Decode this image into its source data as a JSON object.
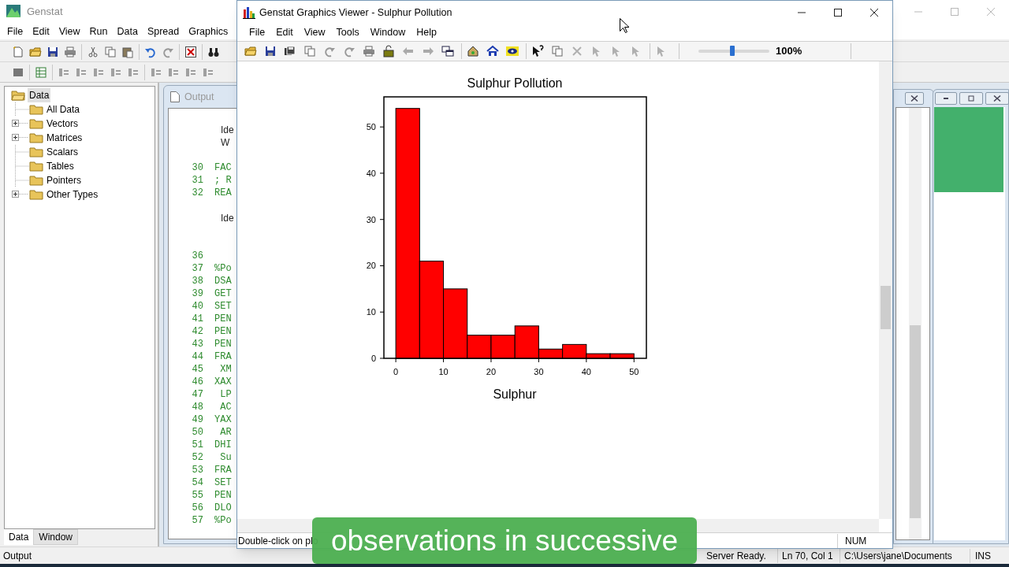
{
  "app": {
    "title": "Genstat",
    "menu": [
      "File",
      "Edit",
      "View",
      "Run",
      "Data",
      "Spread",
      "Graphics"
    ],
    "tree": {
      "label": "Data",
      "selected": true,
      "children": [
        {
          "label": "All Data",
          "expandable": false,
          "selected": false
        },
        {
          "label": "Vectors",
          "expandable": true,
          "selected": false
        },
        {
          "label": "Matrices",
          "expandable": true,
          "selected": false
        },
        {
          "label": "Scalars",
          "expandable": false,
          "selected": false
        },
        {
          "label": "Tables",
          "expandable": false,
          "selected": false
        },
        {
          "label": "Pointers",
          "expandable": false,
          "selected": false
        },
        {
          "label": "Other Types",
          "expandable": true,
          "selected": false
        }
      ]
    },
    "panel_tabs": [
      {
        "label": "Data",
        "selected": true
      },
      {
        "label": "Window",
        "selected": false
      }
    ],
    "status_bar": [
      "Output",
      "Server Ready.",
      "Ln 70, Col 1",
      "C:\\Users\\jane\\Documents",
      "INS"
    ]
  },
  "output_window": {
    "title": "Output",
    "lines": [
      {
        "kind": "heading",
        "text": "Ide"
      },
      {
        "kind": "heading",
        "text": "W"
      },
      {
        "kind": "gap"
      },
      {
        "kind": "code",
        "number": "30",
        "text": "FAC"
      },
      {
        "kind": "code",
        "number": "31",
        "text": "; R"
      },
      {
        "kind": "code",
        "number": "32",
        "text": "REA"
      },
      {
        "kind": "gap"
      },
      {
        "kind": "heading",
        "text": "Ide"
      },
      {
        "kind": "gap"
      },
      {
        "kind": "gap"
      },
      {
        "kind": "code",
        "number": "36"
      },
      {
        "kind": "code",
        "number": "37",
        "text": "%Po"
      },
      {
        "kind": "code",
        "number": "38",
        "text": "DSA"
      },
      {
        "kind": "code",
        "number": "39",
        "text": "GET"
      },
      {
        "kind": "code",
        "number": "40",
        "text": "SET"
      },
      {
        "kind": "code",
        "number": "41",
        "text": "PEN"
      },
      {
        "kind": "code",
        "number": "42",
        "text": "PEN"
      },
      {
        "kind": "code",
        "number": "43",
        "text": "PEN"
      },
      {
        "kind": "code",
        "number": "44",
        "text": "FRA"
      },
      {
        "kind": "code",
        "number": "45",
        "text": " XM"
      },
      {
        "kind": "code",
        "number": "46",
        "text": "XAX"
      },
      {
        "kind": "code",
        "number": "47",
        "text": " LP"
      },
      {
        "kind": "code",
        "number": "48",
        "text": " AC"
      },
      {
        "kind": "code",
        "number": "49",
        "text": "YAX"
      },
      {
        "kind": "code",
        "number": "50",
        "text": " AR"
      },
      {
        "kind": "code",
        "number": "51",
        "text": "DHI"
      },
      {
        "kind": "code",
        "number": "52",
        "text": " Su"
      },
      {
        "kind": "code",
        "number": "53",
        "text": "FRA"
      },
      {
        "kind": "code",
        "number": "54",
        "text": "SET"
      },
      {
        "kind": "code",
        "number": "55",
        "text": "PEN"
      },
      {
        "kind": "code",
        "number": "56",
        "text": "DLO"
      },
      {
        "kind": "code",
        "number": "57",
        "text": "%Po"
      }
    ]
  },
  "graphics_viewer": {
    "title": "Genstat Graphics Viewer - Sulphur Pollution",
    "menu": [
      "File",
      "Edit",
      "View",
      "Tools",
      "Window",
      "Help"
    ],
    "zoom": {
      "level": 0.48,
      "reading": "100%"
    },
    "chart_data": {
      "type": "bar",
      "title": "Sulphur Pollution",
      "xlabel": "Sulphur",
      "x": [
        2.5,
        7.5,
        12.5,
        17.5,
        22.5,
        27.5,
        32.5,
        37.5,
        42.5,
        47.5
      ],
      "values": [
        54,
        21,
        15,
        5,
        5,
        7,
        2,
        3,
        1,
        1
      ],
      "xlim": [
        -2.5,
        52.6
      ],
      "ylim": [
        0,
        56.5
      ],
      "xticks": [
        0,
        10,
        20,
        30,
        40,
        50
      ],
      "yticks": [
        0,
        10,
        20,
        30,
        40,
        50
      ]
    },
    "status_bar": [
      "Double-click on plo",
      "NUM"
    ]
  },
  "caption": "observations in successive"
}
